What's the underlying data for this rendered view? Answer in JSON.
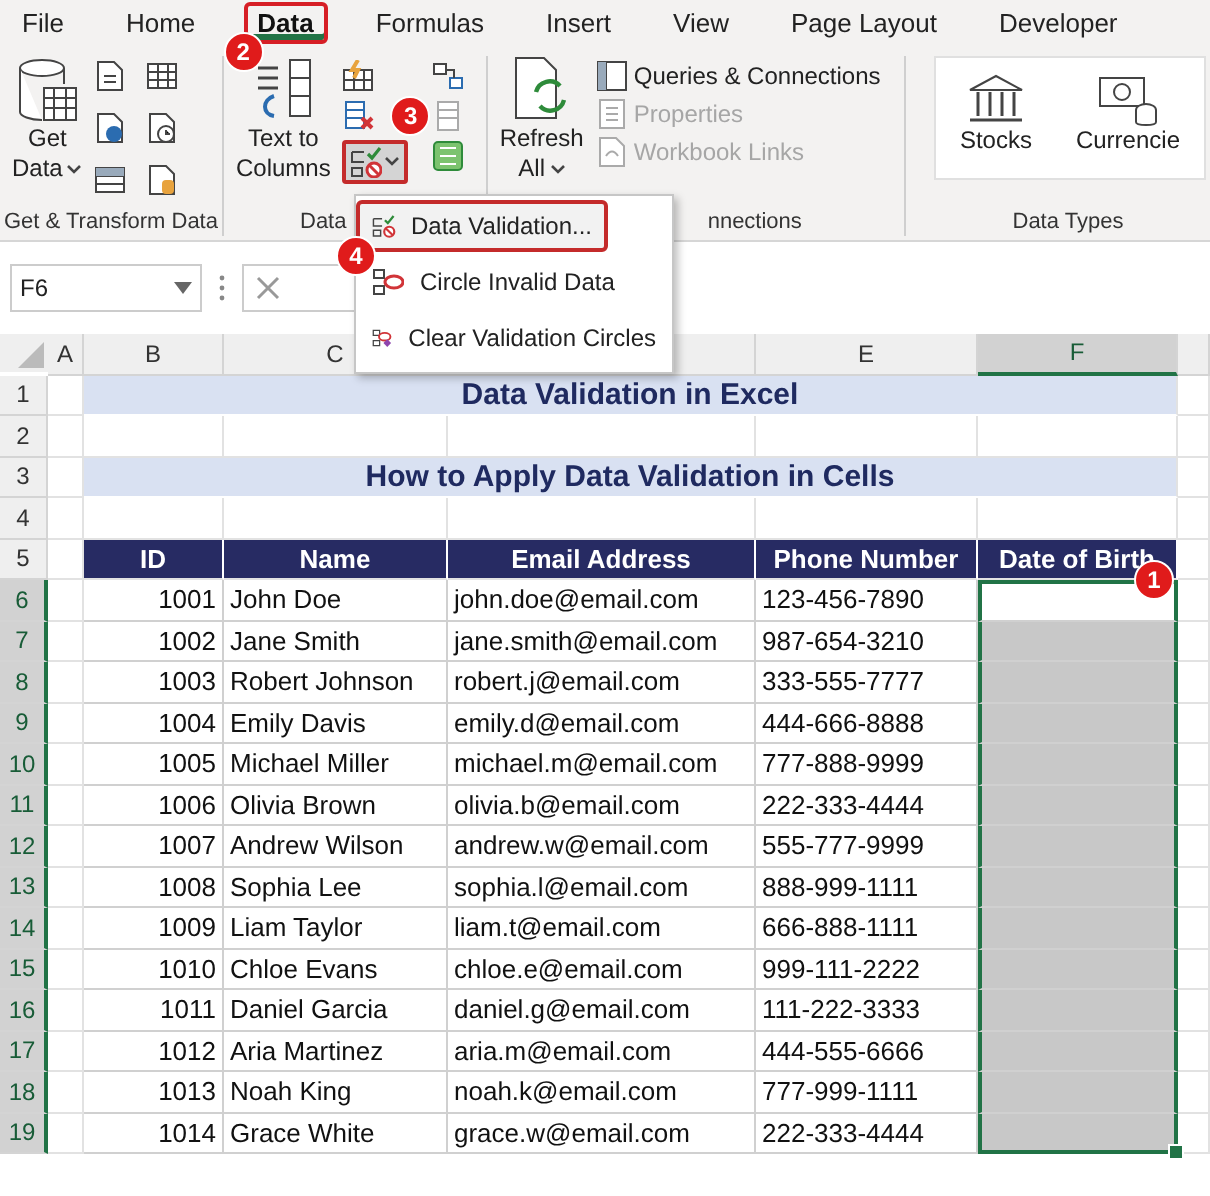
{
  "menu_tabs": [
    {
      "label": "File",
      "selected": false
    },
    {
      "label": "Home",
      "selected": false
    },
    {
      "label": "Data",
      "selected": true,
      "callout": "2"
    },
    {
      "label": "Formulas",
      "selected": false
    },
    {
      "label": "Insert",
      "selected": false
    },
    {
      "label": "View",
      "selected": false
    },
    {
      "label": "Page Layout",
      "selected": false
    },
    {
      "label": "Developer",
      "selected": false
    }
  ],
  "ribbon": {
    "get_data": [
      "Get",
      "Data"
    ],
    "text_to_columns": [
      "Text to",
      "Columns"
    ],
    "validation_button": {
      "callout": "3"
    },
    "refresh_all": [
      "Refresh",
      "All"
    ],
    "queries": [
      {
        "label": "Queries & Connections",
        "disabled": false
      },
      {
        "label": "Properties",
        "disabled": true
      },
      {
        "label": "Workbook Links",
        "disabled": true
      }
    ],
    "data_types": [
      "Stocks",
      "Currencie"
    ],
    "group_labels": [
      "Get & Transform Data",
      "Data",
      "nnections",
      "Data Types"
    ]
  },
  "dropdown": {
    "items": [
      {
        "label": "Data Validation...",
        "selected": true,
        "callout": "4"
      },
      {
        "label": "Circle Invalid Data",
        "selected": false
      },
      {
        "label": "Clear Validation Circles",
        "selected": false
      }
    ]
  },
  "name_box": "F6",
  "sheet": {
    "columns": [
      {
        "label": "A",
        "selected": false
      },
      {
        "label": "B",
        "selected": false
      },
      {
        "label": "C",
        "selected": false
      },
      {
        "selected": false
      },
      {
        "label": "E",
        "selected": false
      },
      {
        "label": "F",
        "selected": true
      }
    ],
    "row_headers": [
      {
        "label": "1",
        "selected": false
      },
      {
        "label": "2",
        "selected": false
      },
      {
        "label": "3",
        "selected": false
      },
      {
        "label": "4",
        "selected": false
      },
      {
        "label": "5",
        "selected": false
      },
      {
        "label": "6",
        "selected": true
      },
      {
        "label": "7",
        "selected": true
      },
      {
        "label": "8",
        "selected": true
      },
      {
        "label": "9",
        "selected": true
      },
      {
        "label": "10",
        "selected": true
      },
      {
        "label": "11",
        "selected": true
      },
      {
        "label": "12",
        "selected": true
      },
      {
        "label": "13",
        "selected": true
      },
      {
        "label": "14",
        "selected": true
      },
      {
        "label": "15",
        "selected": true
      },
      {
        "label": "16",
        "selected": true
      },
      {
        "label": "17",
        "selected": true
      },
      {
        "label": "18",
        "selected": true
      },
      {
        "label": "19",
        "selected": true
      }
    ],
    "title": "Data Validation in Excel",
    "subtitle": "How to Apply Data Validation in Cells",
    "active_cell": {
      "callout": "1"
    },
    "table": {
      "columns": [
        "ID",
        "Name",
        "Email Address",
        "Phone Number",
        "Date of Birth"
      ],
      "rows": [
        {
          "id": "1001",
          "name": "John Doe",
          "email": "john.doe@email.com",
          "phone": "123-456-7890"
        },
        {
          "id": "1002",
          "name": "Jane Smith",
          "email": "jane.smith@email.com",
          "phone": "987-654-3210"
        },
        {
          "id": "1003",
          "name": "Robert Johnson",
          "email": "robert.j@email.com",
          "phone": "333-555-7777"
        },
        {
          "id": "1004",
          "name": "Emily Davis",
          "email": "emily.d@email.com",
          "phone": "444-666-8888"
        },
        {
          "id": "1005",
          "name": "Michael Miller",
          "email": "michael.m@email.com",
          "phone": "777-888-9999"
        },
        {
          "id": "1006",
          "name": "Olivia Brown",
          "email": "olivia.b@email.com",
          "phone": "222-333-4444"
        },
        {
          "id": "1007",
          "name": "Andrew Wilson",
          "email": "andrew.w@email.com",
          "phone": "555-777-9999"
        },
        {
          "id": "1008",
          "name": "Sophia Lee",
          "email": "sophia.l@email.com",
          "phone": "888-999-1111"
        },
        {
          "id": "1009",
          "name": "Liam Taylor",
          "email": "liam.t@email.com",
          "phone": "666-888-1111"
        },
        {
          "id": "1010",
          "name": "Chloe Evans",
          "email": "chloe.e@email.com",
          "phone": "999-111-2222"
        },
        {
          "id": "1011",
          "name": "Daniel Garcia",
          "email": "daniel.g@email.com",
          "phone": "111-222-3333"
        },
        {
          "id": "1012",
          "name": "Aria Martinez",
          "email": "aria.m@email.com",
          "phone": "444-555-6666"
        },
        {
          "id": "1013",
          "name": "Noah King",
          "email": "noah.k@email.com",
          "phone": "777-999-1111"
        },
        {
          "id": "1014",
          "name": "Grace White",
          "email": "grace.w@email.com",
          "phone": "222-333-4444"
        }
      ]
    }
  }
}
